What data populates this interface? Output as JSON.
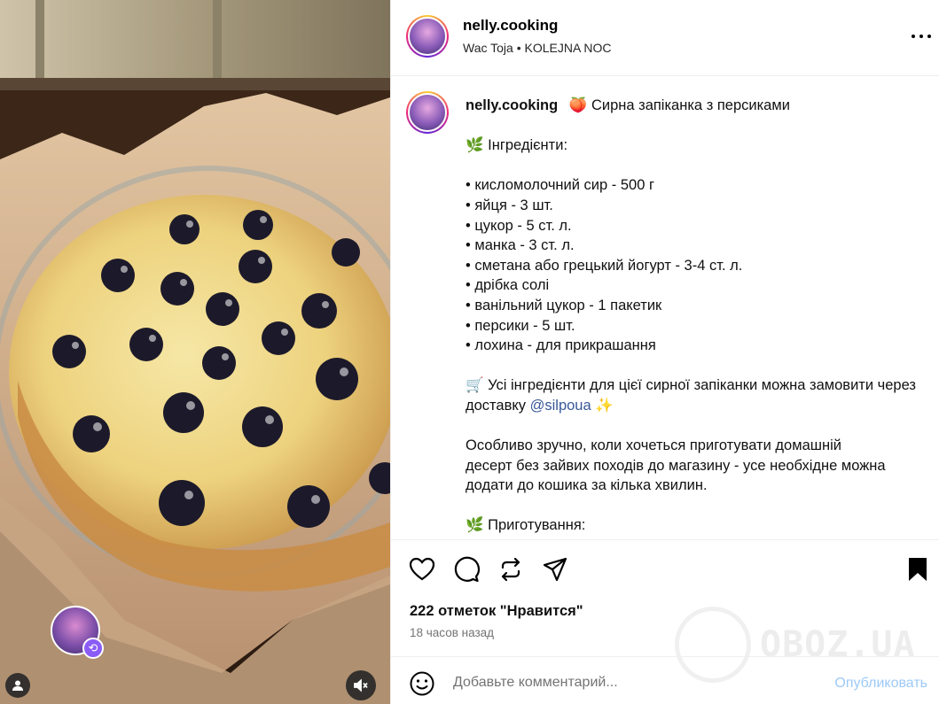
{
  "post": {
    "author": "nelly.cooking",
    "audio": "Wac Toja • KOLEJNA NOC"
  },
  "caption": {
    "author": "nelly.cooking",
    "title_emoji": "🍑",
    "title": "Сирна запіканка з персиками",
    "ingredients_heading_emoji": "🌿",
    "ingredients_heading": "Інгредієнти:",
    "ingredients": [
      "• кисломолочний сир - 500 г",
      "• яйця - 3 шт.",
      "• цукор - 5 ст. л.",
      "• манка - 3 ст. л.",
      "• сметана або грецький йогурт - 3-4 ст. л.",
      "• дрібка солі",
      "• ванільний цукор - 1 пакетик",
      "• персики - 5 шт.",
      "• лохина - для прикрашання"
    ],
    "delivery_emoji": "🛒",
    "delivery_text": "Усі інгредієнти для цієї сирної запіканки можна замовити через доставку",
    "delivery_link": "@silpoua",
    "delivery_end_emoji": "✨",
    "para_line1": "Особливо зручно, коли хочеться приготувати домашній",
    "para_line2": "десерт без зайвих походів до магазину - усе необхідне можна",
    "para_line3": "додати до кошика за кілька хвилин.",
    "prep_heading_emoji": "🌿",
    "prep_heading": "Приготування:"
  },
  "stats": {
    "likes": "222 отметок \"Нравится\"",
    "time": "18 часов назад"
  },
  "comment": {
    "placeholder": "Добавьте комментарий...",
    "publish": "Опубликовать"
  },
  "watermark": "OBOZ.UA",
  "icons": {
    "more": "more-horizontal-icon",
    "like": "heart-icon",
    "comment": "comment-bubble-icon",
    "repost": "repost-icon",
    "share": "send-icon",
    "save": "bookmark-icon",
    "emoji": "smiley-icon",
    "mute": "volume-muted-icon",
    "user_tag": "user-tag-icon"
  },
  "colors": {
    "link": "#385898",
    "publish": "#9dc9f7",
    "muted_text": "#737373",
    "divider": "#efefef"
  }
}
